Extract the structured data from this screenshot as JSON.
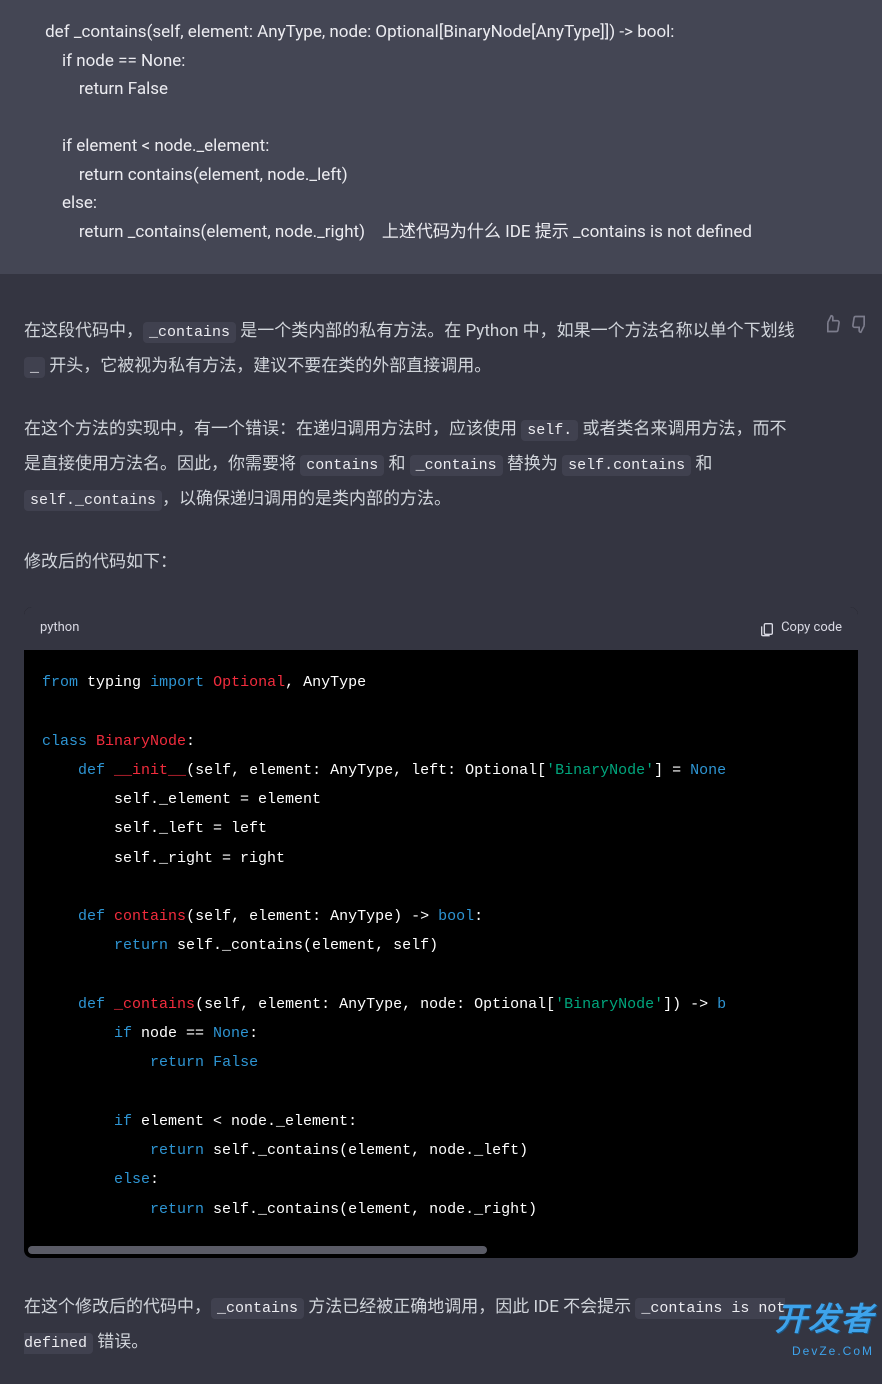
{
  "user": {
    "code": "     def _contains(self, element: AnyType, node: Optional[BinaryNode[AnyType]]) -> bool:\n         if node == None:\n             return False\n\n         if element < node._element:\n             return contains(element, node._left)\n         else:\n             return _contains(element, node._right)",
    "question_text": "上述代码为什么 IDE 提示 _contains is not defined"
  },
  "assistant": {
    "p1_a": "在这段代码中，",
    "p1_code1": "_contains",
    "p1_b": " 是一个类内部的私有方法。在 Python 中，如果一个方法名称以单个下划线 ",
    "p1_code2": "_",
    "p1_c": " 开头，它被视为私有方法，建议不要在类的外部直接调用。",
    "p2_a": "在这个方法的实现中，有一个错误：在递归调用方法时，应该使用 ",
    "p2_code1": "self.",
    "p2_b": " 或者类名来调用方法，而不是直接使用方法名。因此，你需要将 ",
    "p2_code2": "contains",
    "p2_c": " 和 ",
    "p2_code3": "_contains",
    "p2_d": " 替换为 ",
    "p2_code4": "self.contains",
    "p2_e": " 和 ",
    "p2_code5": "self._contains",
    "p2_f": "，以确保递归调用的是类内部的方法。",
    "p3": "修改后的代码如下：",
    "code_lang": "python",
    "copy_label": "Copy code",
    "p4_a": "在这个修改后的代码中，",
    "p4_code1": "_contains",
    "p4_b": " 方法已经被正确地调用，因此 IDE 不会提示 ",
    "p4_code2": "_contains is not defined",
    "p4_c": " 错误。"
  },
  "code": {
    "kw_from": "from",
    "mod_typing": "typing",
    "kw_import": "import",
    "cls_optional": "Optional",
    "cls_anytype": "AnyType",
    "kw_class": "class",
    "cls_binarynode": "BinaryNode",
    "kw_def": "def",
    "fn_init": "__init__",
    "sig_init": "(self, element: AnyType, left: Optional[",
    "str_bn": "'BinaryNode'",
    "sig_init2": "] = ",
    "kw_none": "None",
    "body_init1": "self._element = element",
    "body_init2": "self._left = left",
    "body_init3": "self._right = right",
    "fn_contains": "contains",
    "sig_contains": "(self, element: AnyType) -> ",
    "kw_bool": "bool",
    "kw_return": "return",
    "body_contains": " self._contains(element, self)",
    "fn__contains": "_contains",
    "sig__contains": "(self, element: AnyType, node: Optional[",
    "sig__contains2": "]) -> ",
    "kw_b": "b",
    "kw_if": "if",
    "cond1": " node == ",
    "kw_false": "False",
    "cond2": " element < node._element:",
    "ret2": " self._contains(element, node._left)",
    "kw_else": "else",
    "ret3": " self._contains(element, node._right)"
  },
  "watermark": {
    "main": "开发者",
    "sub": "DevZe.CoM"
  }
}
